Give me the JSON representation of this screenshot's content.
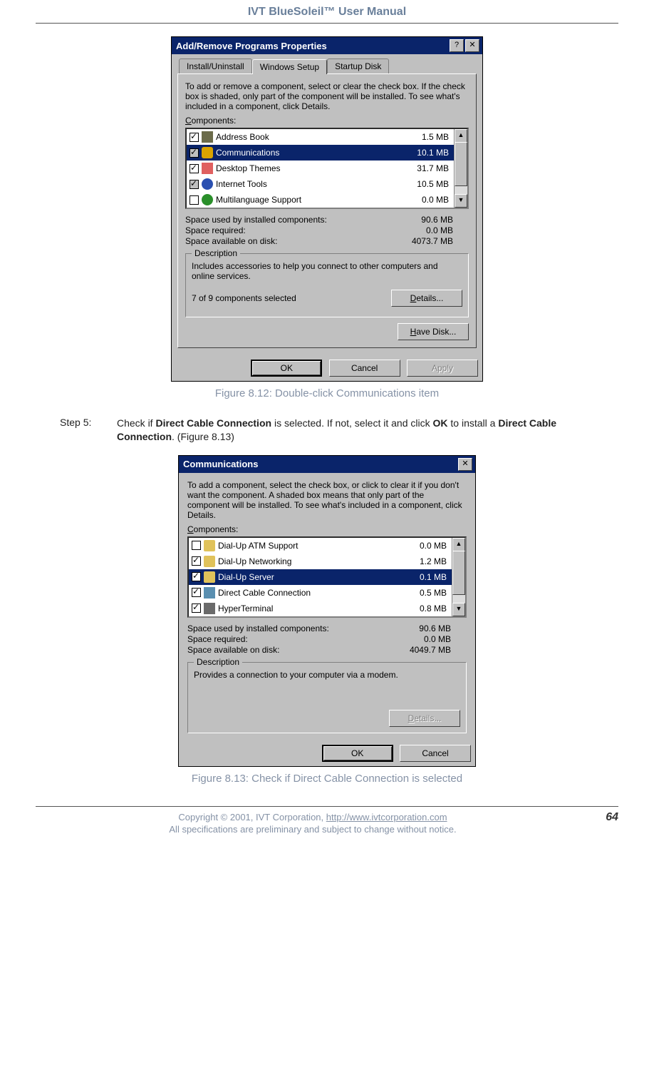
{
  "doc": {
    "title": "IVT BlueSoleil™ User Manual",
    "caption812": "Figure 8.12: Double-click Communications item",
    "caption813": "Figure 8.13: Check if Direct Cable Connection is selected",
    "step5_label": "Step 5:",
    "step5_pre": "Check if ",
    "step5_b1": "Direct Cable Connection",
    "step5_mid": " is selected. If not, select it and click ",
    "step5_b2": "OK",
    "step5_mid2": " to install a ",
    "step5_b3": "Direct Cable Connection",
    "step5_end": ". (Figure 8.13)",
    "copyright": "Copyright © 2001, IVT Corporation, ",
    "url": "http://www.ivtcorporation.com",
    "notice": "All specifications are preliminary and subject to change without notice.",
    "page": "64"
  },
  "dlg1": {
    "title": "Add/Remove Programs Properties",
    "tabs": {
      "t1": "Install/Uninstall",
      "t2": "Windows Setup",
      "t3": "Startup Disk"
    },
    "intro": "To add or remove a component, select or clear the check box. If the check box is shaded, only part of the component will be installed. To see what's included in a component, click Details.",
    "components_label": "Components:",
    "items": [
      {
        "name": "Address Book",
        "size": "1.5 MB",
        "checked": true,
        "shaded": false,
        "selected": false,
        "icon": "ico-book"
      },
      {
        "name": "Communications",
        "size": "10.1 MB",
        "checked": true,
        "shaded": true,
        "selected": true,
        "icon": "ico-comm"
      },
      {
        "name": "Desktop Themes",
        "size": "31.7 MB",
        "checked": true,
        "shaded": false,
        "selected": false,
        "icon": "ico-theme"
      },
      {
        "name": "Internet Tools",
        "size": "10.5 MB",
        "checked": true,
        "shaded": true,
        "selected": false,
        "icon": "ico-ie"
      },
      {
        "name": "Multilanguage Support",
        "size": "0.0 MB",
        "checked": false,
        "shaded": false,
        "selected": false,
        "icon": "ico-multi"
      }
    ],
    "space_used_k": "Space used by installed components:",
    "space_used_v": "90.6 MB",
    "space_req_k": "Space required:",
    "space_req_v": "0.0 MB",
    "space_avail_k": "Space available on disk:",
    "space_avail_v": "4073.7 MB",
    "desc_title": "Description",
    "desc_text": "Includes accessories to help you connect to other computers and online services.",
    "comp_count": "7 of 9 components selected",
    "details": "Details...",
    "havedisk": "Have Disk...",
    "ok": "OK",
    "cancel": "Cancel",
    "apply": "Apply"
  },
  "dlg2": {
    "title": "Communications",
    "intro": "To add a component, select the check box, or click to clear it if you don't want the component. A shaded box means that only part of the component will be installed. To see what's included in a component, click Details.",
    "components_label": "Components:",
    "items": [
      {
        "name": "Dial-Up ATM Support",
        "size": "0.0 MB",
        "checked": false,
        "selected": false,
        "icon": "ico-folder"
      },
      {
        "name": "Dial-Up Networking",
        "size": "1.2 MB",
        "checked": true,
        "selected": false,
        "icon": "ico-folder"
      },
      {
        "name": "Dial-Up Server",
        "size": "0.1 MB",
        "checked": true,
        "selected": true,
        "icon": "ico-folder"
      },
      {
        "name": "Direct Cable Connection",
        "size": "0.5 MB",
        "checked": true,
        "selected": false,
        "icon": "ico-net"
      },
      {
        "name": "HyperTerminal",
        "size": "0.8 MB",
        "checked": true,
        "selected": false,
        "icon": "ico-hyper"
      }
    ],
    "space_used_k": "Space used by installed components:",
    "space_used_v": "90.6 MB",
    "space_req_k": "Space required:",
    "space_req_v": "0.0 MB",
    "space_avail_k": "Space available on disk:",
    "space_avail_v": "4049.7 MB",
    "desc_title": "Description",
    "desc_text": "Provides a connection to your computer via a modem.",
    "details": "Details...",
    "ok": "OK",
    "cancel": "Cancel"
  }
}
